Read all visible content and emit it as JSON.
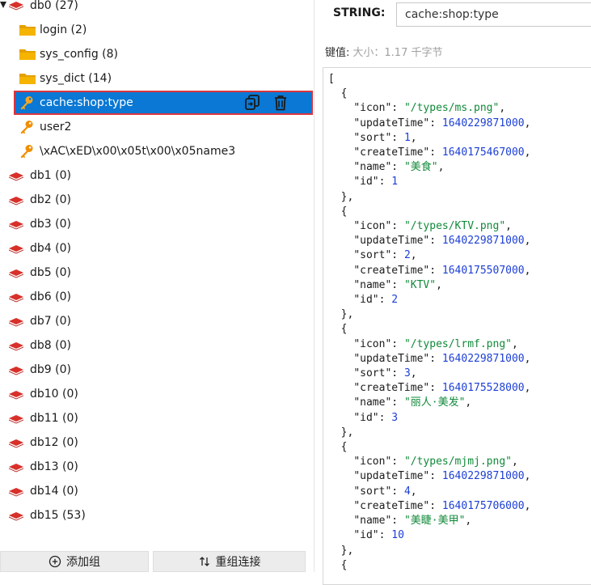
{
  "tree": {
    "db0": {
      "name": "db0",
      "count": "(27)"
    },
    "children": [
      {
        "label": "login (2)",
        "kind": "folder"
      },
      {
        "label": "sys_config (8)",
        "kind": "folder"
      },
      {
        "label": "sys_dict (14)",
        "kind": "folder"
      },
      {
        "label": "cache:shop:type",
        "kind": "key",
        "selected": true
      },
      {
        "label": "user2",
        "kind": "key"
      },
      {
        "label": "\\xAC\\xED\\x00\\x05t\\x00\\x05name3",
        "kind": "key"
      }
    ],
    "dbs": [
      {
        "name": "db1",
        "count": "(0)"
      },
      {
        "name": "db2",
        "count": "(0)"
      },
      {
        "name": "db3",
        "count": "(0)"
      },
      {
        "name": "db4",
        "count": "(0)"
      },
      {
        "name": "db5",
        "count": "(0)"
      },
      {
        "name": "db6",
        "count": "(0)"
      },
      {
        "name": "db7",
        "count": "(0)"
      },
      {
        "name": "db8",
        "count": "(0)"
      },
      {
        "name": "db9",
        "count": "(0)"
      },
      {
        "name": "db10",
        "count": "(0)"
      },
      {
        "name": "db11",
        "count": "(0)"
      },
      {
        "name": "db12",
        "count": "(0)"
      },
      {
        "name": "db13",
        "count": "(0)"
      },
      {
        "name": "db14",
        "count": "(0)"
      },
      {
        "name": "db15",
        "count": "(53)"
      }
    ]
  },
  "buttons": {
    "add_group": "添加组",
    "regroup": "重组连接"
  },
  "detail": {
    "type": "STRING:",
    "key_name": "cache:shop:type",
    "value_label": "键值:",
    "size_label": "大小：1.17 千字节"
  },
  "json_items": [
    {
      "icon": "\"/types/ms.png\"",
      "updateTime": "1640229871000",
      "sort": "1",
      "createTime": "1640175467000",
      "name": "\"美食\"",
      "id": "1"
    },
    {
      "icon": "\"/types/KTV.png\"",
      "updateTime": "1640229871000",
      "sort": "2",
      "createTime": "1640175507000",
      "name": "\"KTV\"",
      "id": "2"
    },
    {
      "icon": "\"/types/lrmf.png\"",
      "updateTime": "1640229871000",
      "sort": "3",
      "createTime": "1640175528000",
      "name": "\"丽人·美发\"",
      "id": "3"
    },
    {
      "icon": "\"/types/mjmj.png\"",
      "updateTime": "1640229871000",
      "sort": "4",
      "createTime": "1640175706000",
      "name": "\"美睫·美甲\"",
      "id": "10"
    }
  ],
  "colors": {
    "accent": "#0a78d4",
    "selection_outline": "#d9363e",
    "folder": "#f5b400",
    "key": "#ef8f00",
    "db": "#d8302a",
    "string": "#118a3a",
    "number": "#1d3fd6"
  },
  "icons": {
    "db": "redis-db-icon",
    "folder": "folder-icon",
    "key": "key-icon",
    "copy": "copy-icon",
    "delete": "trash-icon",
    "add": "plus-circle-icon",
    "regroup": "sort-arrows-icon"
  }
}
